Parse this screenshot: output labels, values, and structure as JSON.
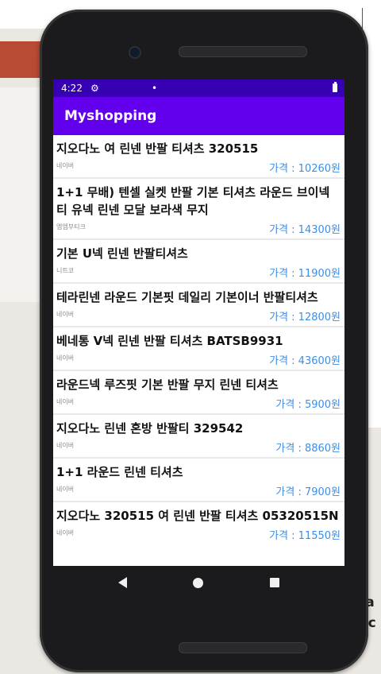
{
  "status": {
    "time": "4:22",
    "gear_icon": "⚙",
    "dot": "•"
  },
  "app": {
    "title": "Myshopping"
  },
  "items": [
    {
      "title": "지오다노 여 린넨 반팔 티셔츠 320515",
      "mall": "네이버",
      "price": "가격 : 10260원"
    },
    {
      "title": "1+1 무배) 텐셀 실켓 반팔 기본 티셔츠 라운드 브이넥 티 유넥 린넨 모달 보라색 무지",
      "mall": "엠엠부티크",
      "price": "가격 : 14300원"
    },
    {
      "title": "기본 U넥 린넨 반팔티셔츠",
      "mall": "니트코",
      "price": "가격 : 11900원"
    },
    {
      "title": "테라린넨 라운드 기본핏 데일리 기본이너 반팔티셔츠",
      "mall": "네이버",
      "price": "가격 : 12800원"
    },
    {
      "title": "베네통 V넥 린넨 반팔 티셔츠 BATSB9931",
      "mall": "네이버",
      "price": "가격 : 43600원"
    },
    {
      "title": "라운드넥 루즈핏 기본 반팔 무지 린넨 티셔츠",
      "mall": "네이버",
      "price": "가격 : 5900원"
    },
    {
      "title": "지오다노 린넨 혼방 반팔티 329542",
      "mall": "네이버",
      "price": "가격 : 8860원"
    },
    {
      "title": "1+1 라운드 린넨 티셔츠",
      "mall": "네이버",
      "price": "가격 : 7900원"
    },
    {
      "title": "지오다노 320515 여 린넨 반팔 티셔츠 05320515N",
      "mall": "네이버",
      "price": "가격 : 11550원"
    }
  ],
  "background": {
    "partial_text_1": "nta",
    "partial_text_2": "anc"
  },
  "colors": {
    "status_bar": "#3700b3",
    "app_bar": "#6200ee",
    "price": "#3d8ee6"
  }
}
